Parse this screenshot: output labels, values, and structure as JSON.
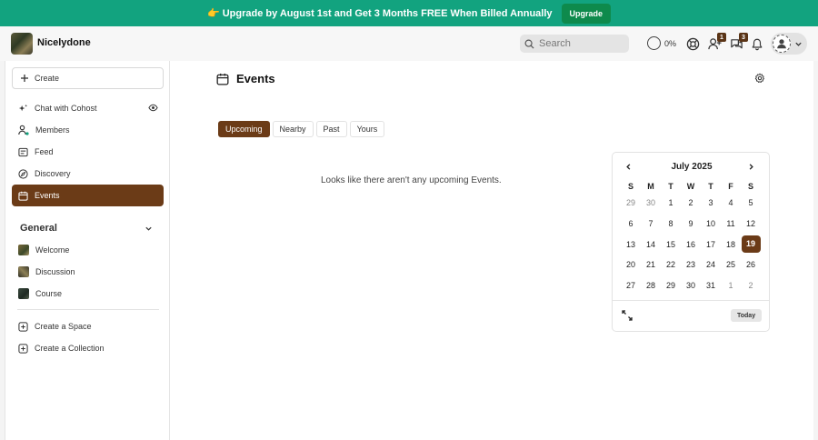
{
  "banner": {
    "text": "👉 Upgrade by August 1st and Get 3 Months FREE When Billed Annually",
    "button": "Upgrade"
  },
  "topbar": {
    "brand": "Nicelydone",
    "search_placeholder": "Search",
    "progress": "0%",
    "invite_badge": "1",
    "chat_badge": "3"
  },
  "sidebar": {
    "create": "Create",
    "nav": [
      {
        "label": "Chat with Cohost"
      },
      {
        "label": "Members"
      },
      {
        "label": "Feed"
      },
      {
        "label": "Discovery"
      },
      {
        "label": "Events"
      }
    ],
    "section": "General",
    "spaces": [
      {
        "label": "Welcome"
      },
      {
        "label": "Discussion"
      },
      {
        "label": "Course"
      }
    ],
    "actions": [
      {
        "label": "Create a Space"
      },
      {
        "label": "Create a Collection"
      }
    ]
  },
  "main": {
    "title": "Events",
    "tabs": [
      "Upcoming",
      "Nearby",
      "Past",
      "Yours"
    ],
    "active_tab": "Upcoming",
    "empty": "Looks like there aren't any upcoming Events."
  },
  "calendar": {
    "month": "July 2025",
    "days_of_week": [
      "S",
      "M",
      "T",
      "W",
      "T",
      "F",
      "S"
    ],
    "weeks": [
      [
        "29",
        "30",
        "1",
        "2",
        "3",
        "4",
        "5"
      ],
      [
        "6",
        "7",
        "8",
        "9",
        "10",
        "11",
        "12"
      ],
      [
        "13",
        "14",
        "15",
        "16",
        "17",
        "18",
        "19"
      ],
      [
        "20",
        "21",
        "22",
        "23",
        "24",
        "25",
        "26"
      ],
      [
        "27",
        "28",
        "29",
        "30",
        "31",
        "1",
        "2"
      ]
    ],
    "selected": "19",
    "today": "Today"
  },
  "colors": {
    "accent": "#6b3b17",
    "banner": "#12a37f",
    "banner_button": "#0e8a4c"
  }
}
